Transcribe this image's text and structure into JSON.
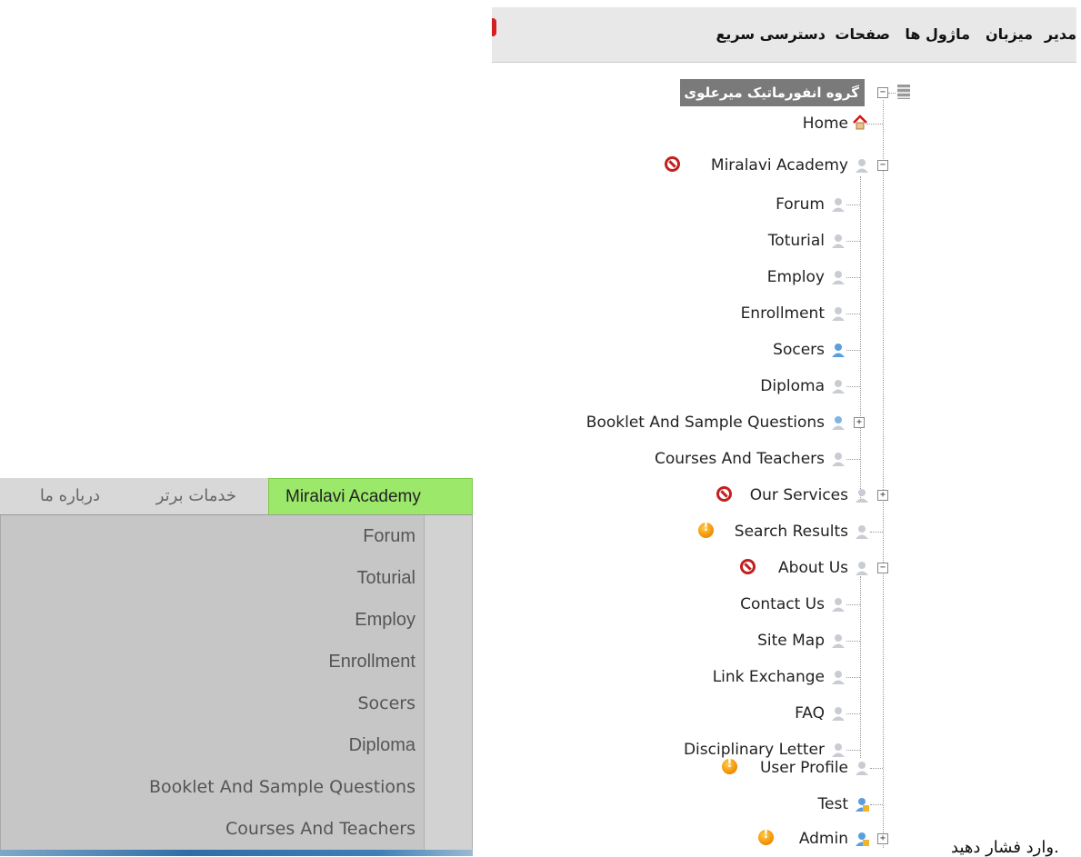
{
  "menu": {
    "tabs": [
      "Miralavi Academy",
      "خدمات برتر",
      "درباره ما"
    ],
    "dropdown_items": [
      "Forum",
      "Toturial",
      "Employ",
      "Enrollment",
      "Socers",
      "Diploma",
      "Booklet And Sample Questions",
      "Courses And Teachers"
    ]
  },
  "admin": {
    "menu": [
      "مدیر",
      "میزبان",
      "ماژول ها",
      "صفحات",
      "دسترسی سریع"
    ],
    "tree": {
      "root": "گروه انفورماتیک میرعلوی",
      "home": "Home",
      "academy": "Miralavi Academy",
      "academy_children": [
        "Forum",
        "Toturial",
        "Employ",
        "Enrollment",
        "Socers",
        "Diploma",
        "Booklet And Sample Questions",
        "Courses And Teachers"
      ],
      "our_services": "Our Services",
      "search_results": "Search Results",
      "about_us": "About Us",
      "about_children": [
        "Contact Us",
        "Site Map",
        "Link Exchange",
        "FAQ",
        "Disciplinary Letter"
      ],
      "user_profile": "User Profile",
      "test": "Test",
      "admin": "Admin"
    }
  },
  "footer_text": "وارد فشار دهید.",
  "colors": {
    "active_tab": "#9be86a",
    "root_bg": "#7a7a7a",
    "stop": "#c41e1e",
    "warning": "#f08a00"
  }
}
